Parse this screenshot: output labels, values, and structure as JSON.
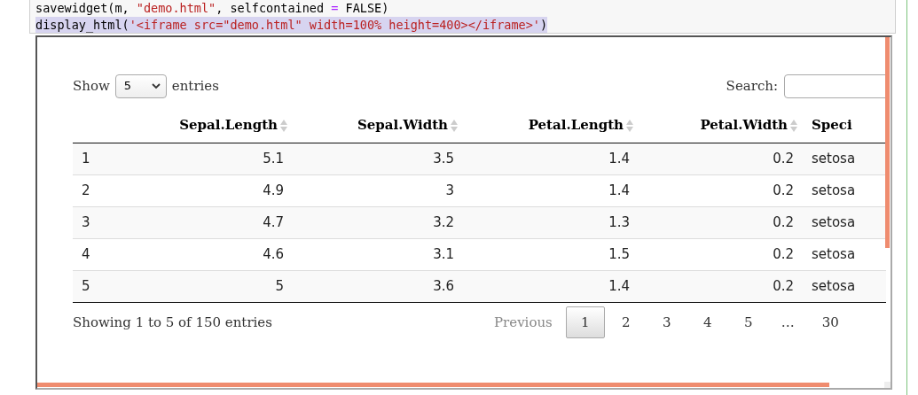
{
  "code_cell": {
    "lines": [
      {
        "selected": false,
        "tokens": [
          {
            "kind": "plain",
            "text": "savewidget(m, "
          },
          {
            "kind": "string",
            "text": "\"demo.html\""
          },
          {
            "kind": "plain",
            "text": ", selfcontained "
          },
          {
            "kind": "operator",
            "text": "="
          },
          {
            "kind": "plain",
            "text": " FALSE)"
          }
        ]
      },
      {
        "selected": true,
        "tokens": [
          {
            "kind": "plain",
            "text": "display_html("
          },
          {
            "kind": "string",
            "text": "'<iframe src=\"demo.html\" width=100% height=400></iframe>'"
          },
          {
            "kind": "plain",
            "text": ")"
          }
        ]
      }
    ]
  },
  "length_control": {
    "label_before": "Show",
    "value": "5",
    "label_after": "entries"
  },
  "search": {
    "label": "Search:"
  },
  "table": {
    "columns": [
      {
        "kind": "index"
      },
      {
        "label": "Sepal.Length",
        "kind": "numeric"
      },
      {
        "label": "Sepal.Width",
        "kind": "numeric"
      },
      {
        "label": "Petal.Length",
        "kind": "numeric"
      },
      {
        "label": "Petal.Width",
        "kind": "numeric"
      },
      {
        "label": "Speci",
        "kind": "text"
      }
    ],
    "rows": [
      [
        "1",
        "5.1",
        "3.5",
        "1.4",
        "0.2",
        "setosa"
      ],
      [
        "2",
        "4.9",
        "3",
        "1.4",
        "0.2",
        "setosa"
      ],
      [
        "3",
        "4.7",
        "3.2",
        "1.3",
        "0.2",
        "setosa"
      ],
      [
        "4",
        "4.6",
        "3.1",
        "1.5",
        "0.2",
        "setosa"
      ],
      [
        "5",
        "5",
        "3.6",
        "1.4",
        "0.2",
        "setosa"
      ]
    ]
  },
  "info": "Showing 1 to 5 of 150 entries",
  "pagination": {
    "previous": {
      "label": "Previous",
      "disabled": true
    },
    "items": [
      {
        "label": "1",
        "kind": "page",
        "selected": true
      },
      {
        "label": "2",
        "kind": "page",
        "selected": false
      },
      {
        "label": "3",
        "kind": "page",
        "selected": false
      },
      {
        "label": "4",
        "kind": "page",
        "selected": false
      },
      {
        "label": "5",
        "kind": "page",
        "selected": false
      },
      {
        "label": "…",
        "kind": "ellipsis"
      },
      {
        "label": "30",
        "kind": "page",
        "selected": false
      }
    ]
  }
}
